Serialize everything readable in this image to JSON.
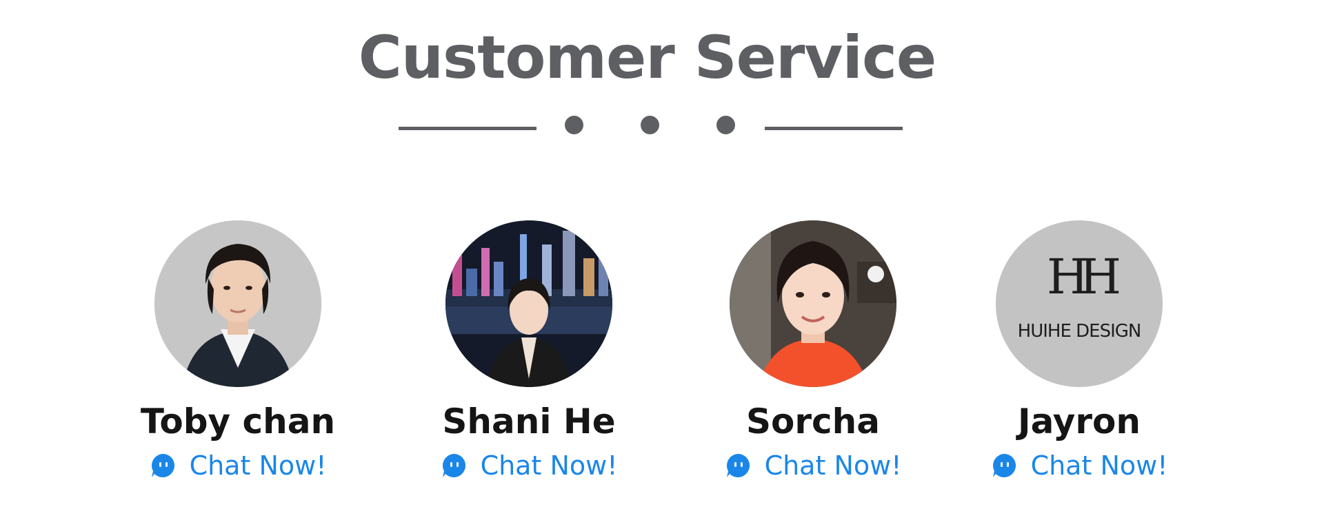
{
  "header": {
    "title": "Customer Service"
  },
  "colors": {
    "title": "#5d5f62",
    "name": "#151515",
    "chat_link": "#1a86e8",
    "avatar_bg": "#c3c3c3"
  },
  "agents": [
    {
      "name": "Toby chan",
      "chat_label": "Chat Now!",
      "chat_icon": "chat-bubble-icon"
    },
    {
      "name": "Shani He",
      "chat_label": "Chat Now!",
      "chat_icon": "chat-bubble-icon"
    },
    {
      "name": "Sorcha",
      "chat_label": "Chat Now!",
      "chat_icon": "chat-bubble-icon"
    },
    {
      "name": "Jayron",
      "chat_label": "Chat Now!",
      "chat_icon": "chat-bubble-icon"
    }
  ],
  "logo": {
    "monogram": "HH",
    "text": "HUIHE DESIGN"
  }
}
